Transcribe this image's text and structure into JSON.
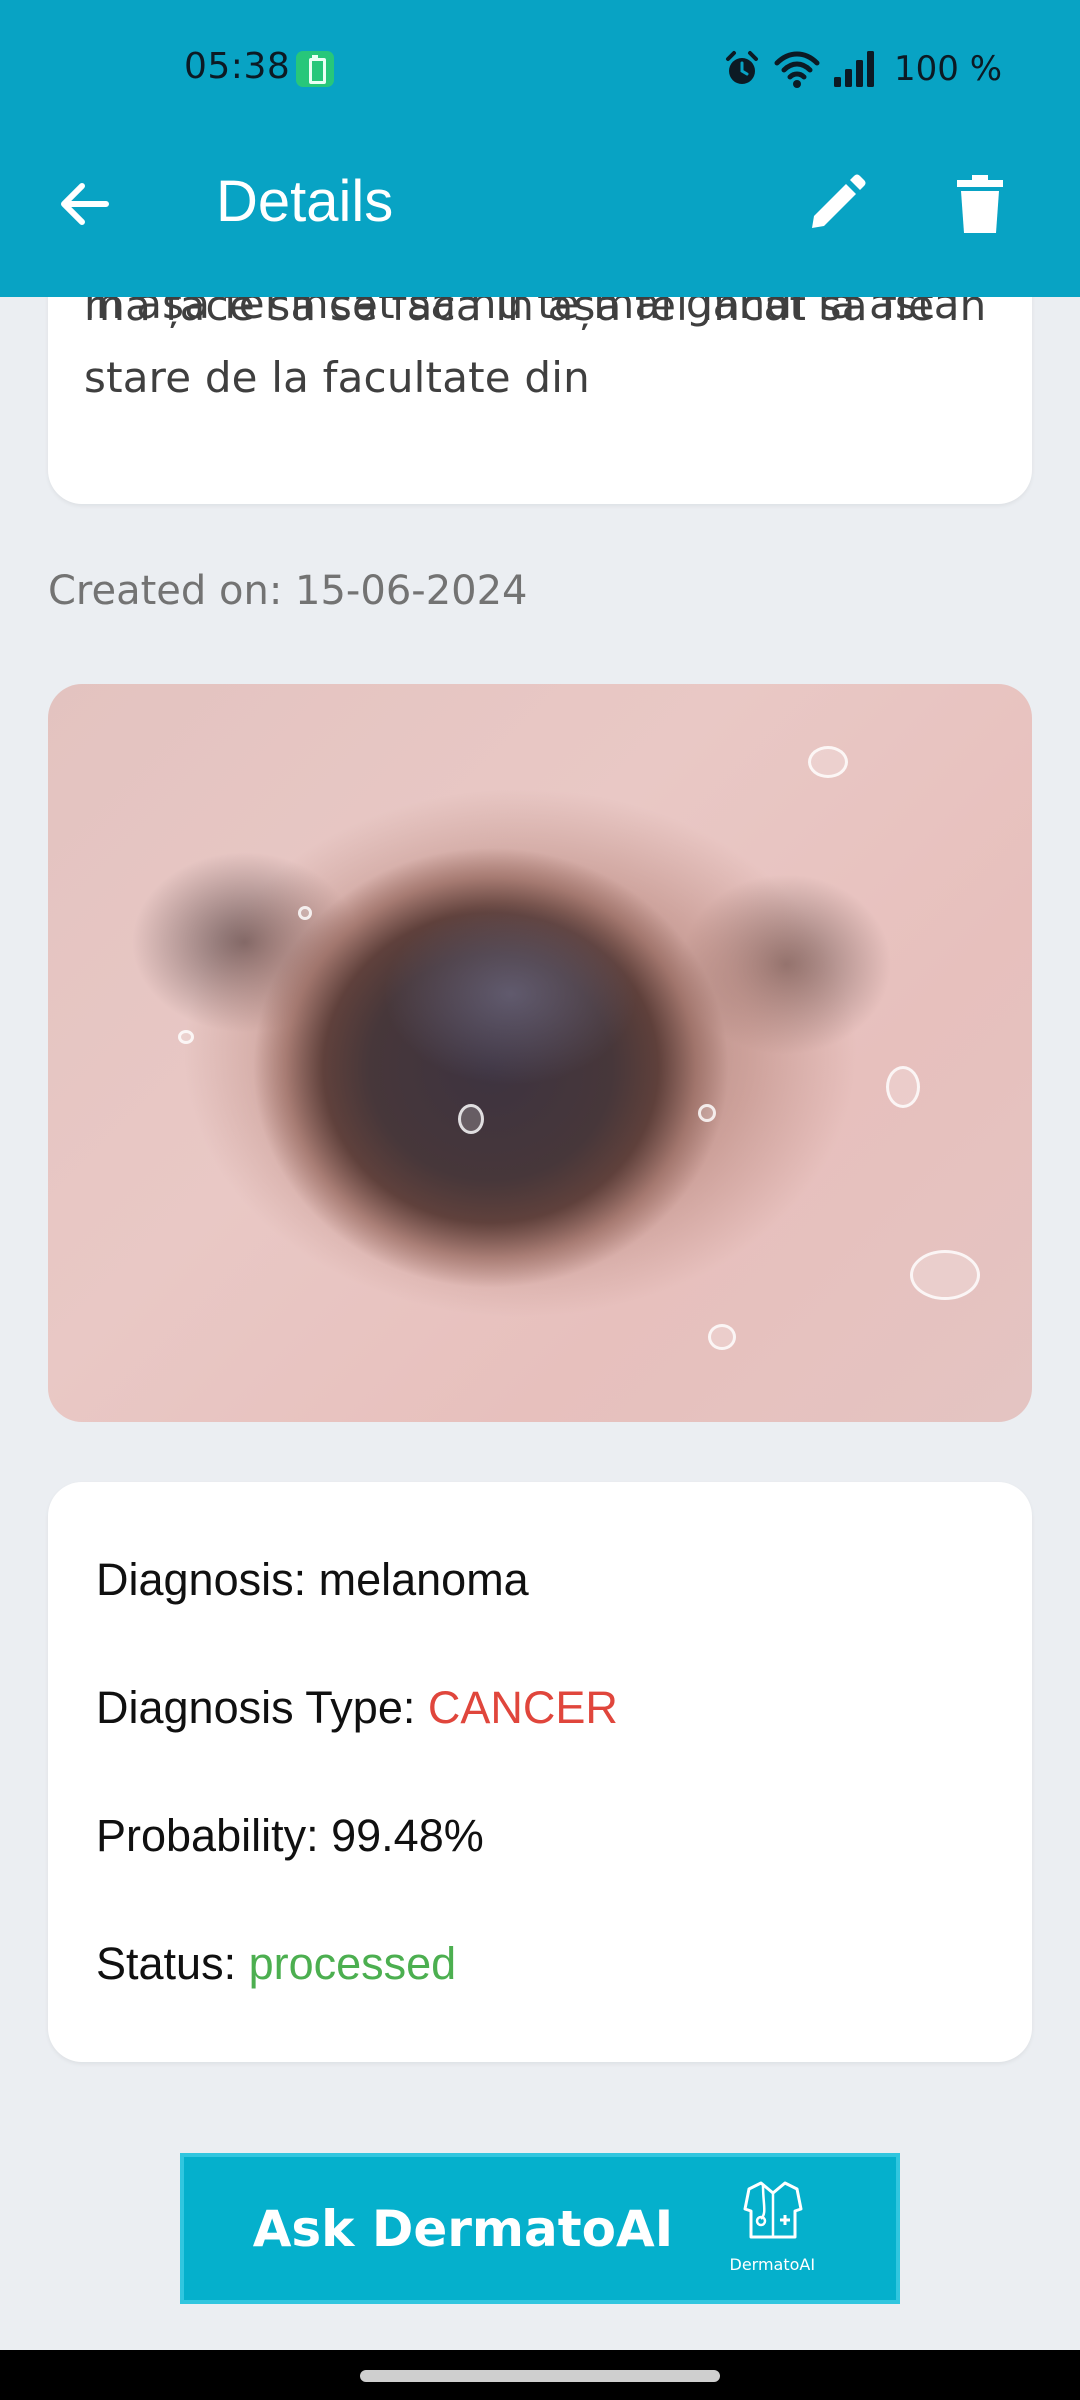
{
  "status_bar": {
    "time": "05:38",
    "battery_percent": "100 %",
    "icons": [
      "battery-saver-icon",
      "alarm-icon",
      "wifi-icon",
      "signal-icon"
    ]
  },
  "app_bar": {
    "title": "Details",
    "back_icon": "arrow-back-icon",
    "edit_icon": "pencil-icon",
    "delete_icon": "trash-icon",
    "background": "#08a3c4"
  },
  "description": {
    "lines": [
      "în așa fel încât să nu te mai gândi la asta",
      "mă face să se facă în așa fel încât să fie în",
      "stare de la facultate din"
    ]
  },
  "created_on": "Created on: 15-06-2024",
  "diagnosis": {
    "diagnosis_label": "Diagnosis: ",
    "diagnosis_value": "melanoma",
    "type_label": "Diagnosis Type: ",
    "type_value": "CANCER",
    "probability_label": "Probability: ",
    "probability_value": "99.48%",
    "status_label": "Status: ",
    "status_value": "processed",
    "type_color": "#e0463c",
    "status_color": "#4caf50"
  },
  "ask_button": {
    "label": "Ask DermatoAI",
    "logo_text": "DermatoAI",
    "logo_icon": "doctor-coat-icon"
  }
}
